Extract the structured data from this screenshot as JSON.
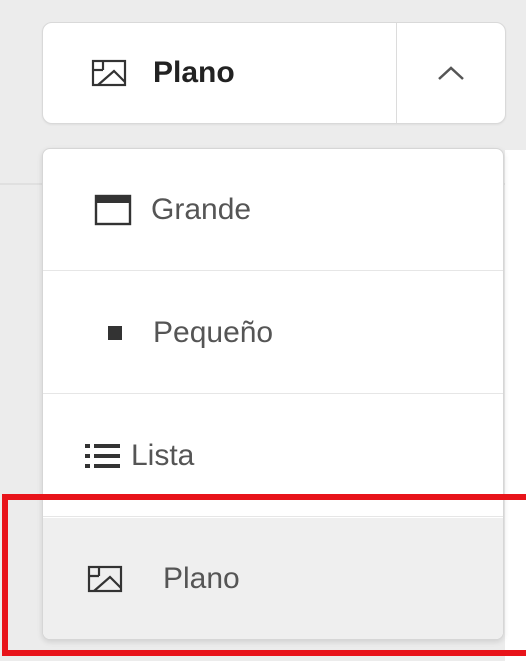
{
  "view_selector": {
    "current_label": "Plano",
    "current_icon": "image-icon",
    "toggle_icon": "chevron-up-icon"
  },
  "menu": {
    "items": [
      {
        "label": "Grande",
        "icon": "large-card-icon"
      },
      {
        "label": "Pequeño",
        "icon": "small-square-icon"
      },
      {
        "label": "Lista",
        "icon": "list-icon"
      },
      {
        "label": "Plano",
        "icon": "image-icon",
        "selected": true
      }
    ]
  },
  "colors": {
    "highlight": "#e8141a",
    "selected_bg": "#efefef"
  }
}
